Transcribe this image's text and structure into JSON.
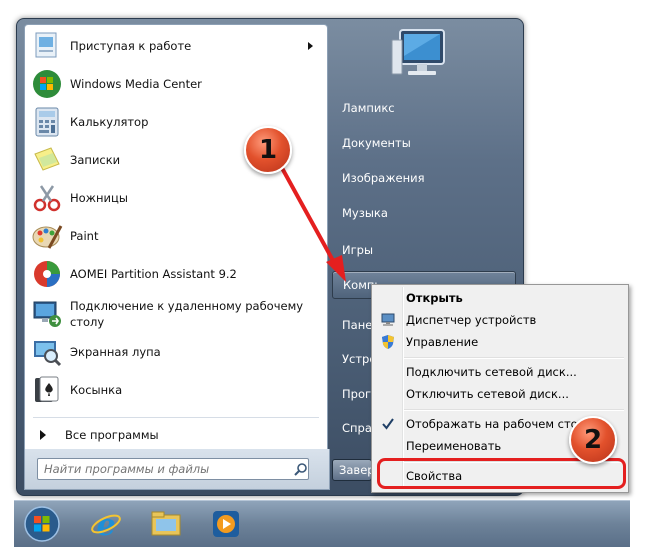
{
  "programs": [
    {
      "label": "Приступая к работе",
      "icon": "getting-started-icon",
      "has_arrow": true
    },
    {
      "label": "Windows Media Center",
      "icon": "media-center-icon"
    },
    {
      "label": "Калькулятор",
      "icon": "calculator-icon"
    },
    {
      "label": "Записки",
      "icon": "sticky-notes-icon"
    },
    {
      "label": "Ножницы",
      "icon": "snipping-tool-icon"
    },
    {
      "label": "Paint",
      "icon": "paint-icon"
    },
    {
      "label": "AOMEI Partition Assistant 9.2",
      "icon": "aomei-icon"
    },
    {
      "label_line1": "Подключение к удаленному рабочему",
      "label_line2": "столу",
      "icon": "remote-desktop-icon"
    },
    {
      "label": "Экранная лупа",
      "icon": "magnifier-icon"
    },
    {
      "label": "Косынка",
      "icon": "solitaire-icon"
    }
  ],
  "all_programs": "Все программы",
  "search": {
    "placeholder": "Найти программы и файлы"
  },
  "right_pane": [
    {
      "label": "Лампикс"
    },
    {
      "label": "Документы"
    },
    {
      "label": "Изображения"
    },
    {
      "label": "Музыка"
    },
    {
      "label": "Игры"
    },
    {
      "label": "Компь"
    },
    {
      "label": "Пане"
    },
    {
      "label": "Устро"
    },
    {
      "label": "Прог"
    },
    {
      "label": "Спра"
    }
  ],
  "shutdown_label": "Завер",
  "context_menu": {
    "items": [
      {
        "label": "Открыть",
        "bold": true
      },
      {
        "label": "Диспетчер устройств",
        "icon": "device-manager-icon"
      },
      {
        "label": "Управление",
        "icon": "shield-icon"
      },
      {
        "label": "Подключить сетевой диск..."
      },
      {
        "label": "Отключить сетевой диск..."
      },
      {
        "label": "Отображать на рабочем столе",
        "checked": true
      },
      {
        "label": "Переименовать"
      },
      {
        "label": "Свойства"
      }
    ]
  },
  "annotations": {
    "badge1": "1",
    "badge2": "2"
  },
  "taskbar": {
    "icons": [
      "start-orb-icon",
      "internet-explorer-icon",
      "explorer-icon",
      "media-player-icon"
    ]
  },
  "colors": {
    "accent": "#e41f1f",
    "menu_bg": "#5d7088"
  }
}
